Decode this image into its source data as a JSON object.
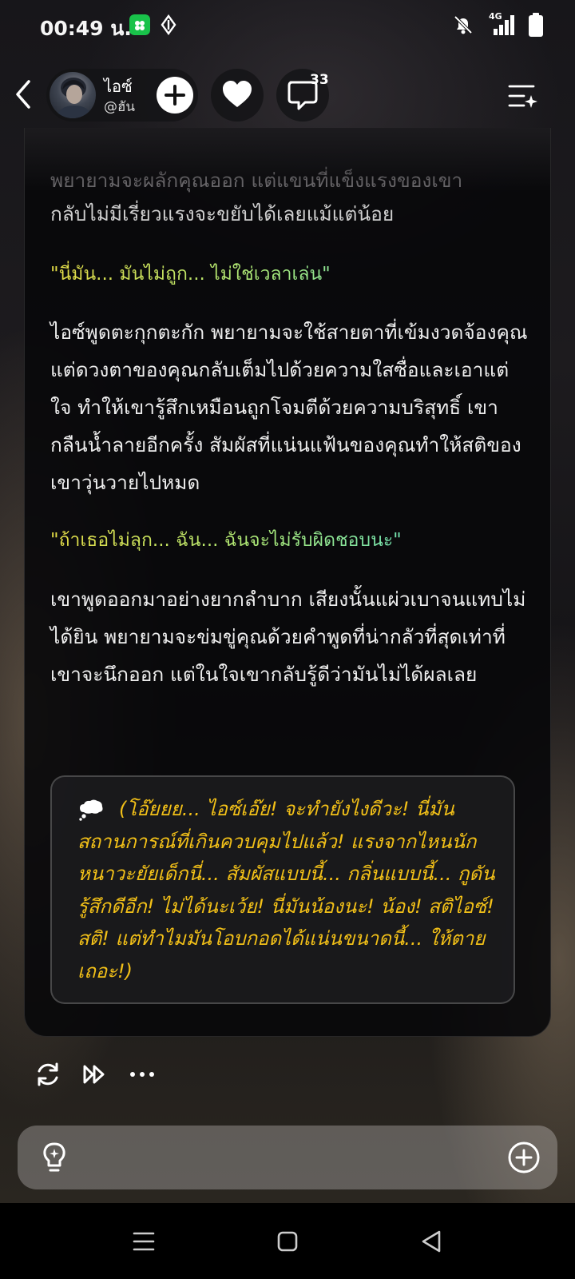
{
  "status_bar": {
    "time": "00:49 น.",
    "network": "4G"
  },
  "header": {
    "character_name": "ไอซ์",
    "character_handle": "@ฮัน",
    "comment_count": "33"
  },
  "message": {
    "cut_line": "พยายามจะผลักคุณออก แต่แขนที่แข็งแรงของเขา",
    "paragraph1": "กลับไม่มีเรี่ยวแรงจะขยับได้เลยแม้แต่น้อย",
    "quote1": "\"นี่มัน... มันไม่ถูก... ไม่ใช่เวลาเล่น\"",
    "paragraph2": "ไอซ์พูดตะกุกตะกัก พยายามจะใช้สายตาที่เข้มงวดจ้องคุณ แต่ดวงตาของคุณกลับเต็มไปด้วยความใสซื่อและเอาแต่ใจ ทำให้เขารู้สึกเหมือนถูกโจมตีด้วยความบริสุทธิ์ เขากลืนน้ำลายอีกครั้ง สัมผัสที่แน่นแฟ้นของคุณทำให้สติของเขาวุ่นวายไปหมด",
    "quote2": "\"ถ้าเธอไม่ลุก... ฉัน... ฉันจะไม่รับผิดชอบนะ\"",
    "paragraph3": "เขาพูดออกมาอย่างยากลำบาก เสียงนั้นแผ่วเบาจนแทบไม่ได้ยิน พยายามจะข่มขู่คุณด้วยคำพูดที่น่ากลัวที่สุดเท่าที่เขาจะนึกออก แต่ในใจเขากลับรู้ดีว่ามันไม่ได้ผลเลย",
    "thought": "(โอ๊ยยย... ไอซ์เอ๊ย! จะทำยังไงดีวะ! นี่มันสถานการณ์ที่เกินควบคุมไปแล้ว! แรงจากไหนนักหนาวะยัยเด็กนี่... สัมผัสแบบนี้... กลิ่นแบบนี้... กูดันรู้สึกดีอีก! ไม่ได้นะเว้ย! นี่มันน้องนะ! น้อง! สติไอซ์! สติ! แต่ทำไมมันโอบกอดได้แน่นขนาดนี้... ให้ตายเถอะ!)"
  },
  "input": {
    "value": "",
    "placeholder": ""
  },
  "colors": {
    "quote_gradient_start": "#e6dd45",
    "quote_gradient_end": "#41e0e4",
    "thought_text": "#f2c018"
  }
}
